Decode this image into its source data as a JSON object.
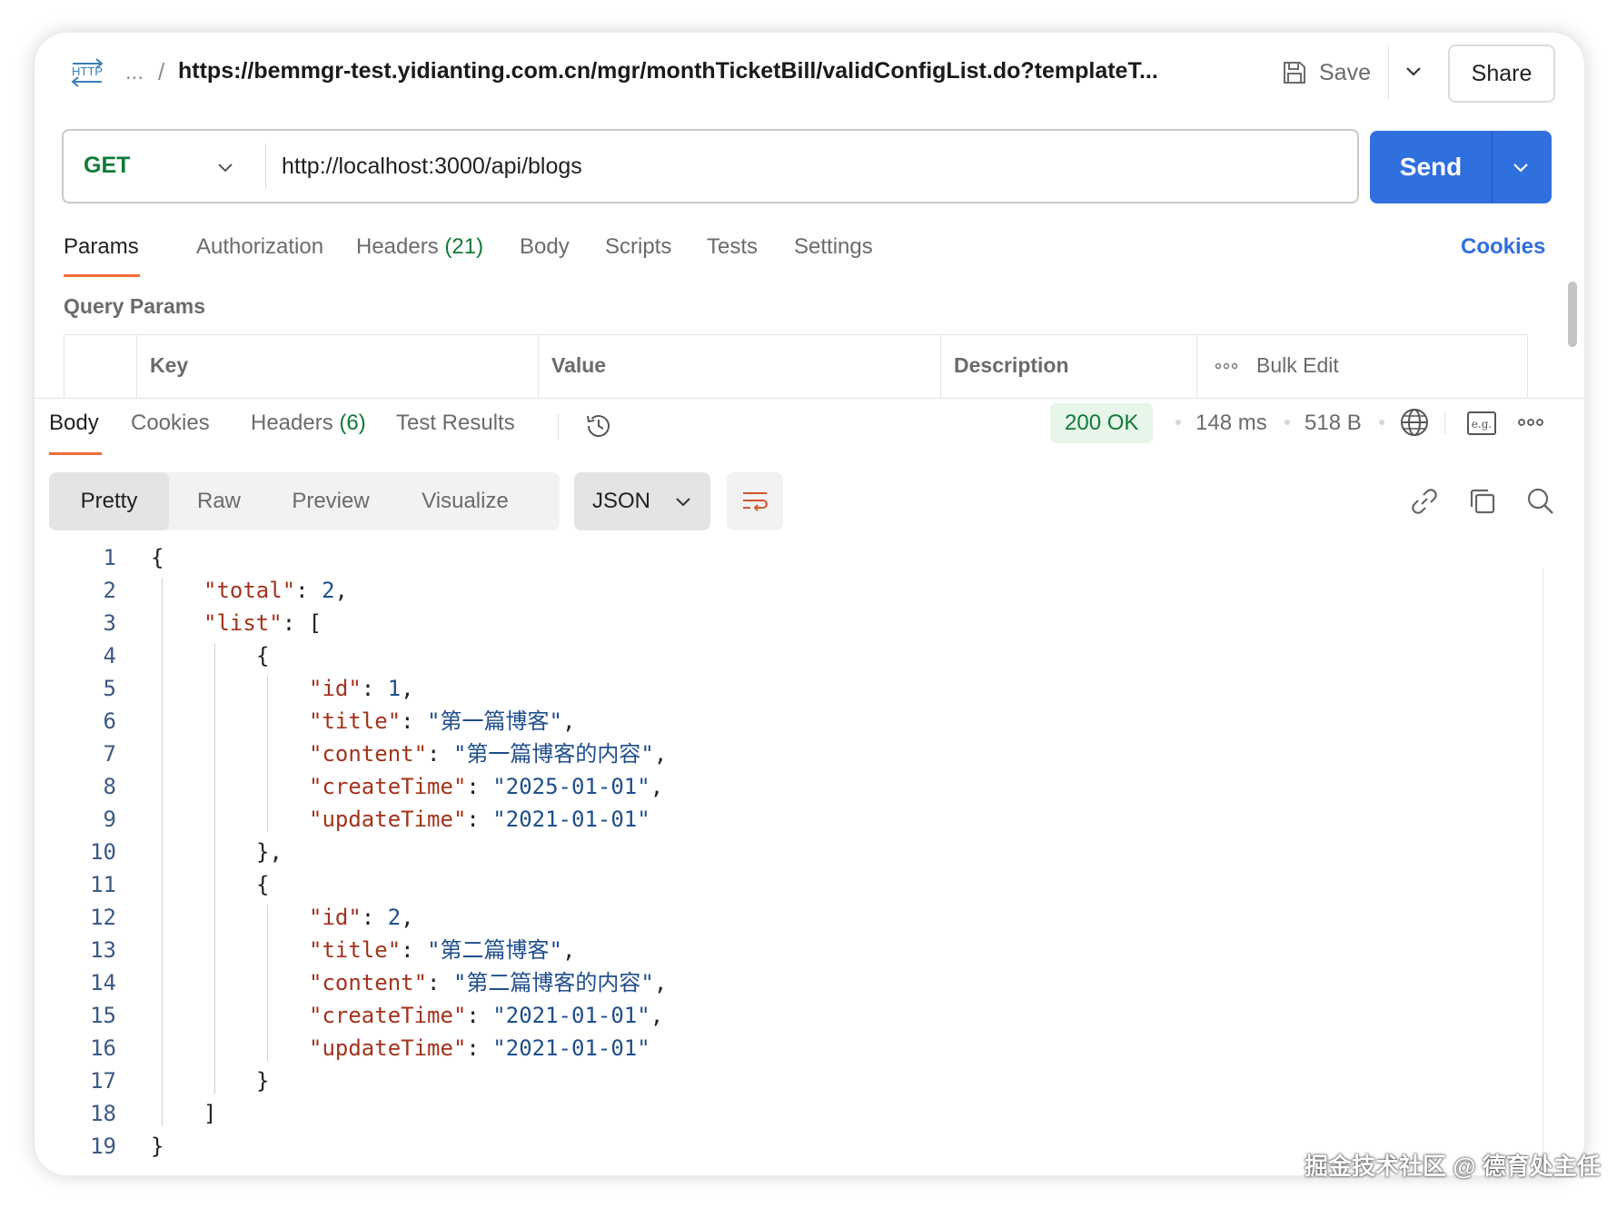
{
  "topbar": {
    "http_icon_text": "HTTP",
    "breadcrumb_ellipsis": "...",
    "breadcrumb_separator": "/",
    "request_title": "https://bemmgr-test.yidianting.com.cn/mgr/monthTicketBill/validConfigList.do?templateT...",
    "save_label": "Save",
    "share_label": "Share"
  },
  "request": {
    "method": "GET",
    "url": "http://localhost:3000/api/blogs",
    "send_label": "Send"
  },
  "request_tabs": {
    "params": "Params",
    "authorization": "Authorization",
    "headers": "Headers",
    "headers_count": "(21)",
    "body": "Body",
    "scripts": "Scripts",
    "tests": "Tests",
    "settings": "Settings",
    "cookies": "Cookies"
  },
  "query_params": {
    "title": "Query Params",
    "columns": [
      "Key",
      "Value",
      "Description"
    ],
    "bulk_edit": "Bulk Edit"
  },
  "response_tabs": {
    "body": "Body",
    "cookies": "Cookies",
    "headers": "Headers",
    "headers_count": "(6)",
    "test_results": "Test Results"
  },
  "response_meta": {
    "status": "200 OK",
    "time": "148 ms",
    "size": "518 B",
    "status_color": "#0f7b36"
  },
  "view_options": {
    "pretty": "Pretty",
    "raw": "Raw",
    "preview": "Preview",
    "visualize": "Visualize",
    "format": "JSON"
  },
  "code_lines": [
    {
      "n": "1",
      "indent": 0,
      "parts": [
        [
          "p",
          "{"
        ]
      ]
    },
    {
      "n": "2",
      "indent": 1,
      "parts": [
        [
          "k",
          "\"total\""
        ],
        [
          "p",
          ": "
        ],
        [
          "n",
          "2"
        ],
        [
          "p",
          ","
        ]
      ]
    },
    {
      "n": "3",
      "indent": 1,
      "parts": [
        [
          "k",
          "\"list\""
        ],
        [
          "p",
          ": ["
        ]
      ]
    },
    {
      "n": "4",
      "indent": 2,
      "parts": [
        [
          "p",
          "{"
        ]
      ]
    },
    {
      "n": "5",
      "indent": 3,
      "parts": [
        [
          "k",
          "\"id\""
        ],
        [
          "p",
          ": "
        ],
        [
          "n",
          "1"
        ],
        [
          "p",
          ","
        ]
      ]
    },
    {
      "n": "6",
      "indent": 3,
      "parts": [
        [
          "k",
          "\"title\""
        ],
        [
          "p",
          ": "
        ],
        [
          "s",
          "\"第一篇博客\""
        ],
        [
          "p",
          ","
        ]
      ]
    },
    {
      "n": "7",
      "indent": 3,
      "parts": [
        [
          "k",
          "\"content\""
        ],
        [
          "p",
          ": "
        ],
        [
          "s",
          "\"第一篇博客的内容\""
        ],
        [
          "p",
          ","
        ]
      ]
    },
    {
      "n": "8",
      "indent": 3,
      "parts": [
        [
          "k",
          "\"createTime\""
        ],
        [
          "p",
          ": "
        ],
        [
          "s",
          "\"2025-01-01\""
        ],
        [
          "p",
          ","
        ]
      ]
    },
    {
      "n": "9",
      "indent": 3,
      "parts": [
        [
          "k",
          "\"updateTime\""
        ],
        [
          "p",
          ": "
        ],
        [
          "s",
          "\"2021-01-01\""
        ]
      ]
    },
    {
      "n": "10",
      "indent": 2,
      "parts": [
        [
          "p",
          "},"
        ]
      ]
    },
    {
      "n": "11",
      "indent": 2,
      "parts": [
        [
          "p",
          "{"
        ]
      ]
    },
    {
      "n": "12",
      "indent": 3,
      "parts": [
        [
          "k",
          "\"id\""
        ],
        [
          "p",
          ": "
        ],
        [
          "n",
          "2"
        ],
        [
          "p",
          ","
        ]
      ]
    },
    {
      "n": "13",
      "indent": 3,
      "parts": [
        [
          "k",
          "\"title\""
        ],
        [
          "p",
          ": "
        ],
        [
          "s",
          "\"第二篇博客\""
        ],
        [
          "p",
          ","
        ]
      ]
    },
    {
      "n": "14",
      "indent": 3,
      "parts": [
        [
          "k",
          "\"content\""
        ],
        [
          "p",
          ": "
        ],
        [
          "s",
          "\"第二篇博客的内容\""
        ],
        [
          "p",
          ","
        ]
      ]
    },
    {
      "n": "15",
      "indent": 3,
      "parts": [
        [
          "k",
          "\"createTime\""
        ],
        [
          "p",
          ": "
        ],
        [
          "s",
          "\"2021-01-01\""
        ],
        [
          "p",
          ","
        ]
      ]
    },
    {
      "n": "16",
      "indent": 3,
      "parts": [
        [
          "k",
          "\"updateTime\""
        ],
        [
          "p",
          ": "
        ],
        [
          "s",
          "\"2021-01-01\""
        ]
      ]
    },
    {
      "n": "17",
      "indent": 2,
      "parts": [
        [
          "p",
          "}"
        ]
      ]
    },
    {
      "n": "18",
      "indent": 1,
      "parts": [
        [
          "p",
          "]"
        ]
      ]
    },
    {
      "n": "19",
      "indent": 0,
      "parts": [
        [
          "p",
          "}"
        ]
      ]
    }
  ],
  "colors": {
    "accent": "#2f6fde",
    "tab_underline": "#f26b3a",
    "json_key": "#a3331c",
    "json_value": "#1f4e8c"
  },
  "icons": {
    "http": "http-icon",
    "save": "save-icon",
    "history": "history-icon",
    "globe": "globe-icon",
    "example": "eg-icon",
    "more": "more-icon",
    "wrap": "wrap-lines-icon",
    "link": "link-icon",
    "copy": "copy-icon",
    "search": "search-icon"
  },
  "watermark": "掘金技术社区 @ 德育处主任"
}
